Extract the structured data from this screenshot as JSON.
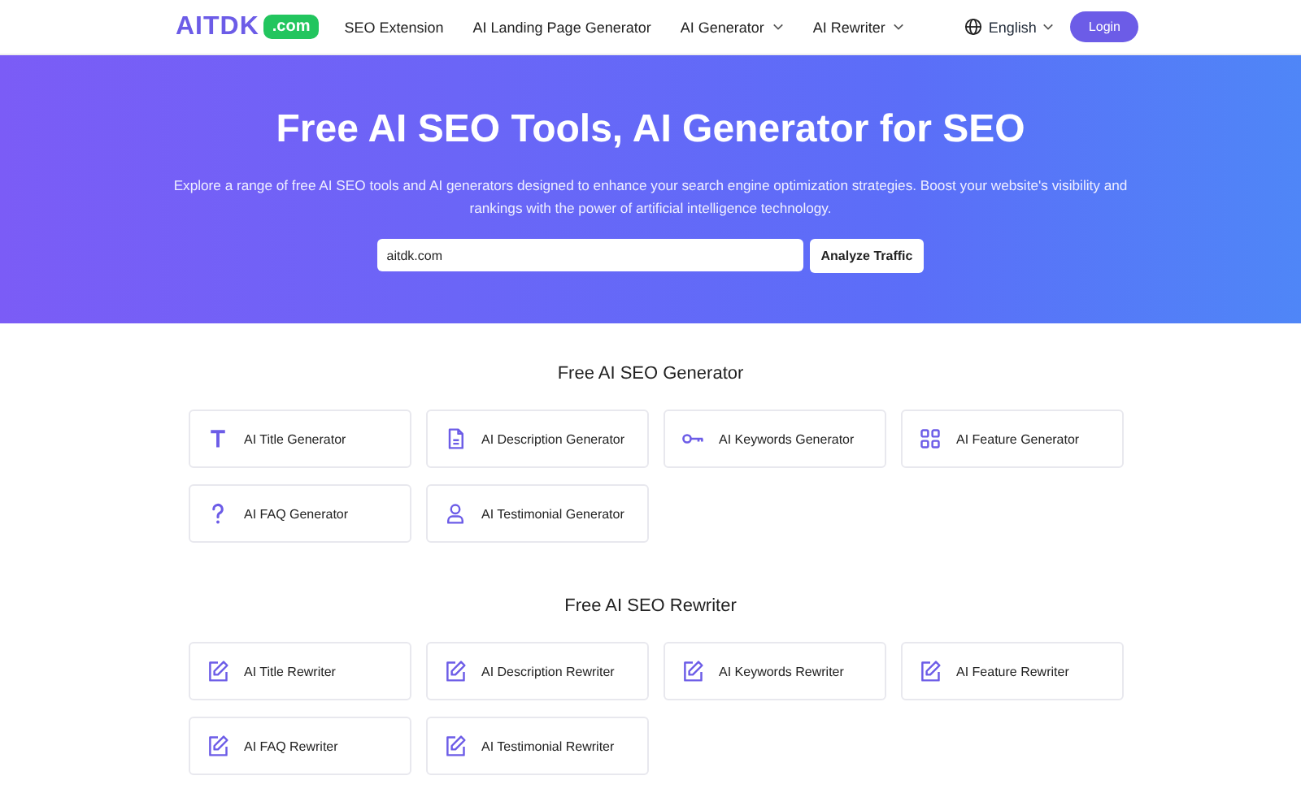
{
  "nav": {
    "logo": "AITDK",
    "logo_badge": ".com",
    "links": [
      {
        "label": "SEO Extension",
        "dropdown": false
      },
      {
        "label": "AI Landing Page Generator",
        "dropdown": false
      },
      {
        "label": "AI Generator",
        "dropdown": true
      },
      {
        "label": "AI Rewriter",
        "dropdown": true
      }
    ],
    "language": "English",
    "login": "Login"
  },
  "hero": {
    "title": "Free AI SEO Tools, AI Generator for SEO",
    "description": "Explore a range of free AI SEO tools and AI generators designed to enhance your search engine optimization strategies. Boost your website's visibility and rankings with the power of artificial intelligence technology.",
    "search_value": "aitdk.com",
    "button": "Analyze Traffic"
  },
  "sections": [
    {
      "title": "Free AI SEO Generator",
      "tools": [
        {
          "label": "AI Title Generator",
          "kind": "title"
        },
        {
          "label": "AI Description Generator",
          "kind": "document"
        },
        {
          "label": "AI Keywords Generator",
          "kind": "key"
        },
        {
          "label": "AI Feature Generator",
          "kind": "grid"
        },
        {
          "label": "AI FAQ Generator",
          "kind": "question"
        },
        {
          "label": "AI Testimonial Generator",
          "kind": "person"
        }
      ]
    },
    {
      "title": "Free AI SEO Rewriter",
      "tools": [
        {
          "label": "AI Title Rewriter",
          "kind": "edit"
        },
        {
          "label": "AI Description Rewriter",
          "kind": "edit"
        },
        {
          "label": "AI Keywords Rewriter",
          "kind": "edit"
        },
        {
          "label": "AI Feature Rewriter",
          "kind": "edit"
        },
        {
          "label": "AI FAQ Rewriter",
          "kind": "edit"
        },
        {
          "label": "AI Testimonial Rewriter",
          "kind": "edit"
        }
      ]
    }
  ]
}
